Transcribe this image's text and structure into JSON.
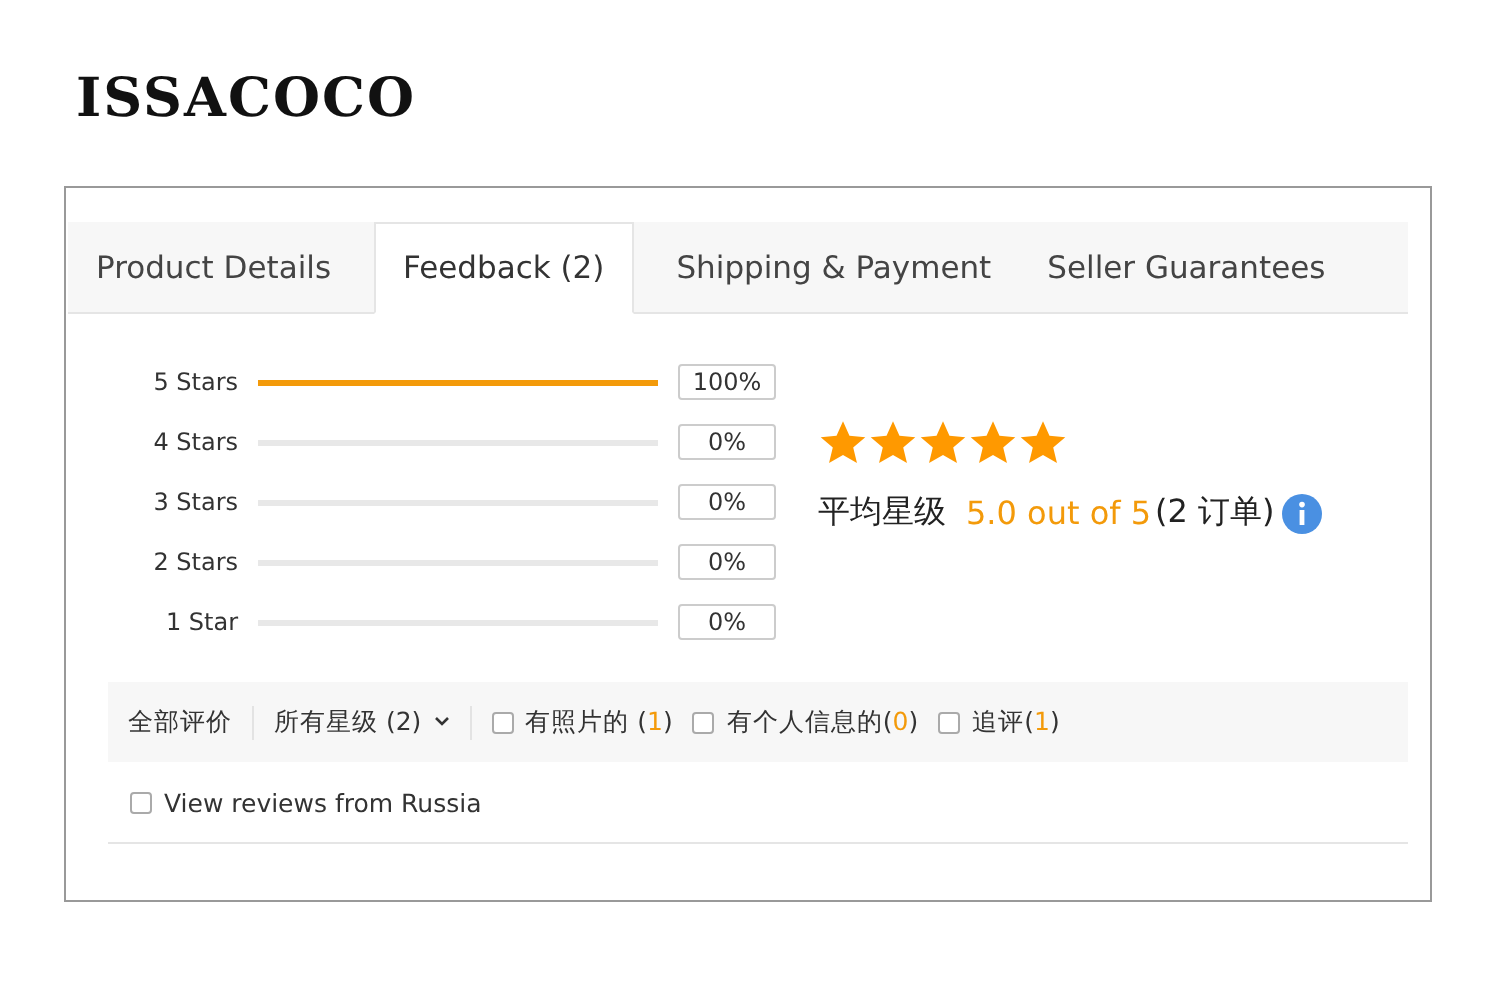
{
  "logo": "ISSACOCO",
  "tabs": [
    {
      "label": "Product Details",
      "selected": false
    },
    {
      "label": "Feedback (2)",
      "selected": true
    },
    {
      "label": "Shipping & Payment",
      "selected": false
    },
    {
      "label": "Seller Guarantees",
      "selected": false
    }
  ],
  "histogram": [
    {
      "label": "5 Stars",
      "level": 1,
      "reading": "100%"
    },
    {
      "label": "4 Stars",
      "level": 0,
      "reading": "0%"
    },
    {
      "label": "3 Stars",
      "level": 0,
      "reading": "0%"
    },
    {
      "label": "2 Stars",
      "level": 0,
      "reading": "0%"
    },
    {
      "label": "1 Star",
      "level": 0,
      "reading": "0%"
    }
  ],
  "summary": {
    "stars": 5,
    "label": "平均星级",
    "score": "5.0 out of 5",
    "orders": "(2 订单)"
  },
  "filters": {
    "all": "全部评价",
    "dropdown": "所有星级 (2)",
    "options": [
      {
        "label": "有照片的 (",
        "count": "1",
        "suffix": ")",
        "checked": false
      },
      {
        "label": "有个人信息的(",
        "count": "0",
        "suffix": ")",
        "checked": false
      },
      {
        "label": "追评(",
        "count": "1",
        "suffix": ")",
        "checked": false
      }
    ]
  },
  "russia": {
    "label": "View reviews from Russia",
    "checked": false
  }
}
